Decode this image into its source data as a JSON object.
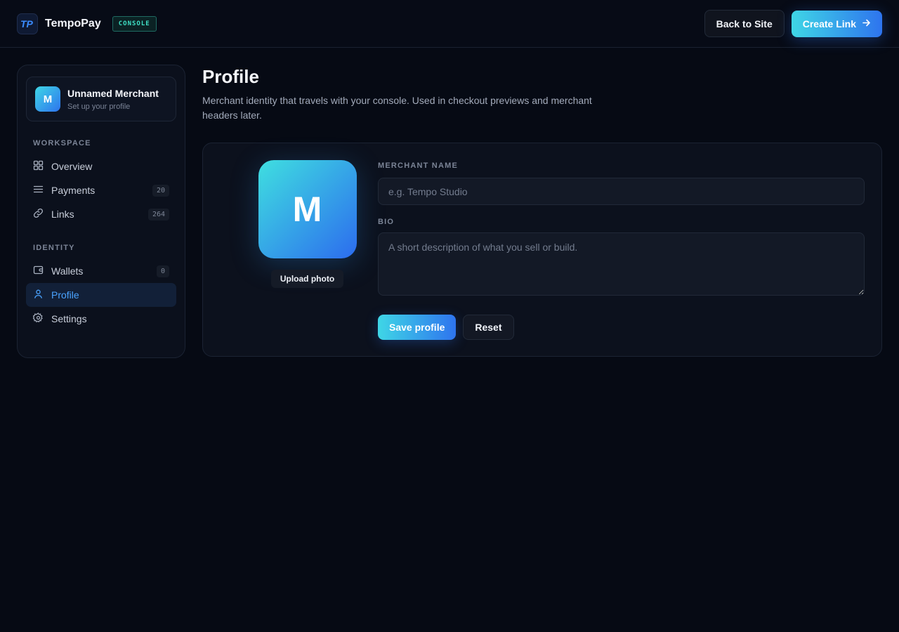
{
  "header": {
    "brand_name": "TempoPay",
    "badge": "CONSOLE",
    "back_label": "Back to Site",
    "create_label": "Create Link",
    "logo_icon": "tempopay-logo-icon",
    "arrow_icon": "arrow-right-icon"
  },
  "sidebar": {
    "merchant": {
      "initial": "M",
      "name": "Unnamed Merchant",
      "subtitle": "Set up your profile"
    },
    "sections": [
      {
        "label": "WORKSPACE",
        "items": [
          {
            "label": "Overview",
            "icon": "grid-icon",
            "count": ""
          },
          {
            "label": "Payments",
            "icon": "list-icon",
            "count": "20"
          },
          {
            "label": "Links",
            "icon": "link-icon",
            "count": "264"
          }
        ]
      },
      {
        "label": "IDENTITY",
        "items": [
          {
            "label": "Wallets",
            "icon": "wallet-icon",
            "count": "0"
          },
          {
            "label": "Profile",
            "icon": "user-icon",
            "count": "",
            "active": true
          },
          {
            "label": "Settings",
            "icon": "gear-icon",
            "count": ""
          }
        ]
      }
    ]
  },
  "main": {
    "title": "Profile",
    "description": "Merchant identity that travels with your console. Used in checkout previews and merchant headers later.",
    "avatar_initial": "M",
    "upload_label": "Upload photo",
    "name_label": "MERCHANT NAME",
    "name_value": "",
    "name_placeholder": "e.g. Tempo Studio",
    "bio_label": "BIO",
    "bio_value": "",
    "bio_placeholder": "A short description of what you sell or build.",
    "save_label": "Save profile",
    "reset_label": "Reset"
  },
  "colors": {
    "background": "#060a14",
    "accent_start": "#3fd6e6",
    "accent_end": "#2e74ee",
    "active_text": "#4aa3ff",
    "badge_text": "#3fe0c5"
  }
}
